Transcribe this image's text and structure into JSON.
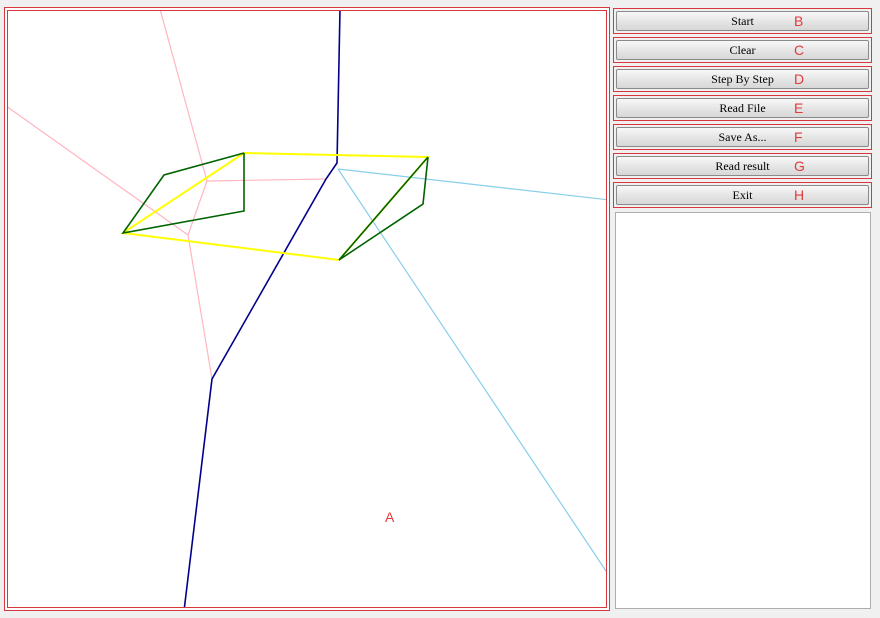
{
  "canvas": {
    "marker": "A"
  },
  "buttons": [
    {
      "label": "Start",
      "marker": "B"
    },
    {
      "label": "Clear",
      "marker": "C"
    },
    {
      "label": "Step By Step",
      "marker": "D"
    },
    {
      "label": "Read File",
      "marker": "E"
    },
    {
      "label": "Save As...",
      "marker": "F"
    },
    {
      "label": "Read result",
      "marker": "G"
    },
    {
      "label": "Exit",
      "marker": "H"
    }
  ],
  "colors": {
    "frame": "#d9363e",
    "hull": "#ffff00",
    "triangulation": "#006400",
    "voronoi_left": "#ffb6c1",
    "voronoi_right": "#87ceeb",
    "hyperplane": "#00008b"
  }
}
